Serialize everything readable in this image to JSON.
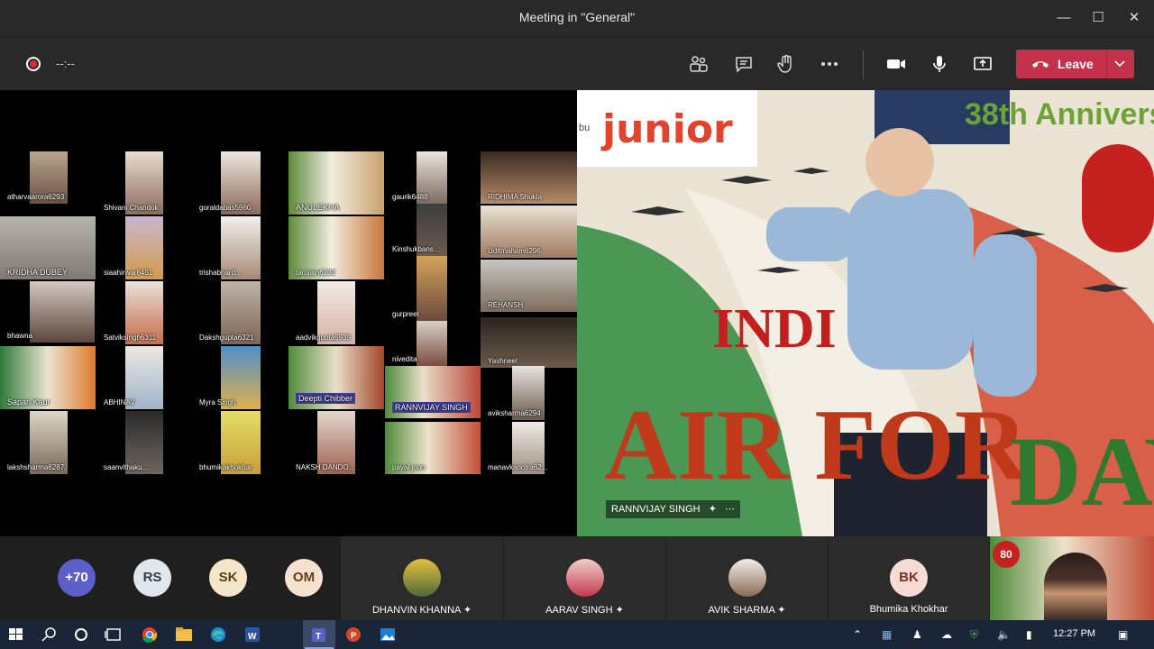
{
  "window": {
    "title": "Meeting in \"General\""
  },
  "toolbar": {
    "timer": "--:--",
    "leave_label": "Leave"
  },
  "grid_tiles": [
    {
      "name": "atharvaarora6293"
    },
    {
      "name": "Shivani Chandok"
    },
    {
      "name": "goraldabas5960"
    },
    {
      "name": "ANULEKHA"
    },
    {
      "name": "gaurik6488"
    },
    {
      "name": "RIDHIMA Shukla"
    },
    {
      "name": "KRIDHA  DUBEY"
    },
    {
      "name": "siaahirwar6451"
    },
    {
      "name": "trishabhard..."
    },
    {
      "name": "tarujain6232"
    },
    {
      "name": "Kinshukbans..."
    },
    {
      "name": "Uditmaham6296"
    },
    {
      "name": "bhawna"
    },
    {
      "name": "Satviksingh6311"
    },
    {
      "name": "Dakshgupta6321"
    },
    {
      "name": "aadvikgupta5939"
    },
    {
      "name": "gurpreet"
    },
    {
      "name": "REHANSH"
    },
    {
      "name": "Sapan Kaur"
    },
    {
      "name": "ABHINAV"
    },
    {
      "name": "Myra Singh"
    },
    {
      "name": "Deepti Chibber"
    },
    {
      "name": "RANNVIJAY  SINGH"
    },
    {
      "name": "nivedita"
    },
    {
      "name": "Yashneel"
    },
    {
      "name": "lakshsharma6287"
    },
    {
      "name": "saanvithaku..."
    },
    {
      "name": "bhumikakhokhar"
    },
    {
      "name": "NAKSH  DANDO..."
    },
    {
      "name": "payal joon"
    },
    {
      "name": "aviksharma6294"
    },
    {
      "name": "manavkanotra62..."
    }
  ],
  "stage": {
    "participant_name": "RANNVIJAY SINGH",
    "banner_top": "38th Annivers",
    "brand": "junior",
    "brand_prefix": "bu",
    "headline1": "INDI",
    "headline2": "AIR FOR",
    "headline3": "DAY!"
  },
  "bottom": {
    "overflow_count": "+70",
    "initials": [
      {
        "text": "RS",
        "bg": "#dfe6ec",
        "fg": "#2e3d4e"
      },
      {
        "text": "SK",
        "bg": "#f6e6c9",
        "fg": "#5a3f10"
      },
      {
        "text": "OM",
        "bg": "#f7e1cf",
        "fg": "#6a3a1a"
      }
    ],
    "participants": [
      {
        "name": "DHANVIN KHANNA"
      },
      {
        "name": "AARAV SINGH"
      },
      {
        "name": "AVIK SHARMA"
      },
      {
        "name": "Bhumika Khokhar",
        "initials": "BK"
      }
    ],
    "self_view_badge": "80"
  },
  "taskbar": {
    "time": "12:27 PM"
  },
  "colors": {
    "leave": "#c4314b",
    "overflow_bg": "#5b5fc7",
    "taskbar": "#1a2638"
  }
}
